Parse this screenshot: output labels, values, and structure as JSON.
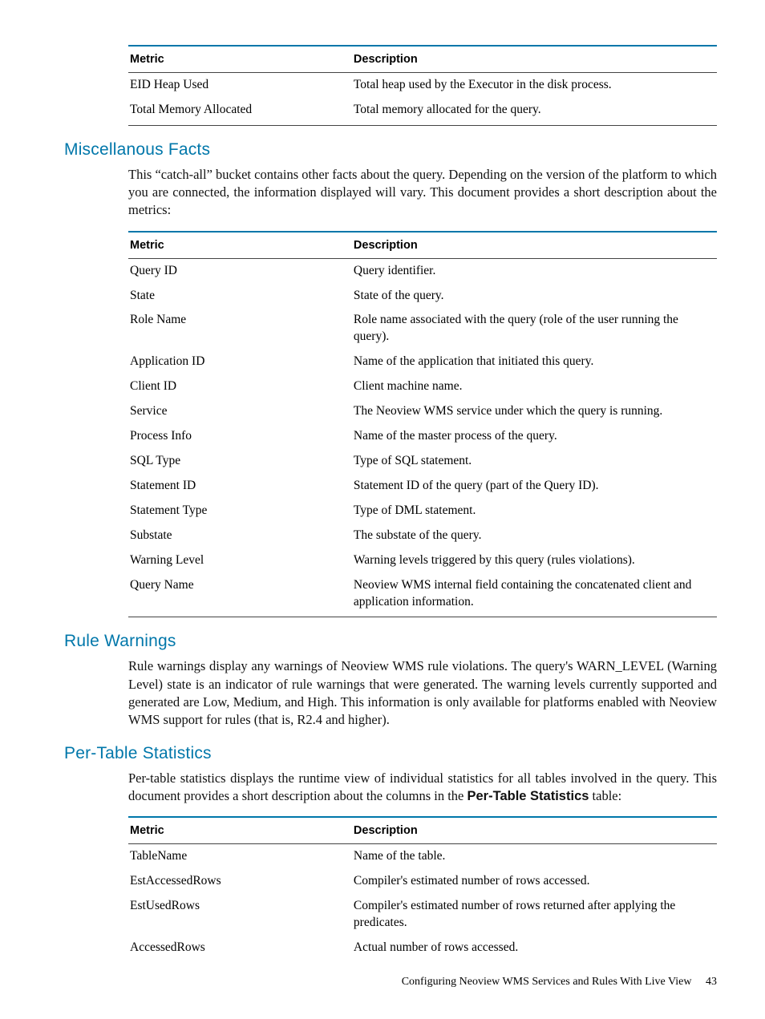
{
  "tables": {
    "heap": {
      "headers": {
        "metric": "Metric",
        "desc": "Description"
      },
      "rows": [
        {
          "metric": "EID Heap Used",
          "desc": "Total heap used by the Executor in the disk process."
        },
        {
          "metric": "Total Memory Allocated",
          "desc": "Total memory allocated for the query."
        }
      ]
    },
    "misc": {
      "headers": {
        "metric": "Metric",
        "desc": "Description"
      },
      "rows": [
        {
          "metric": "Query ID",
          "desc": "Query identifier."
        },
        {
          "metric": "State",
          "desc": "State of the query."
        },
        {
          "metric": "Role Name",
          "desc": "Role name associated with the query (role of the user running the query)."
        },
        {
          "metric": "Application ID",
          "desc": "Name of the application that initiated this query."
        },
        {
          "metric": "Client ID",
          "desc": "Client machine name."
        },
        {
          "metric": "Service",
          "desc": "The Neoview WMS service under which the query is running."
        },
        {
          "metric": "Process Info",
          "desc": "Name of the master process of the query."
        },
        {
          "metric": "SQL Type",
          "desc": "Type of SQL statement."
        },
        {
          "metric": "Statement ID",
          "desc": "Statement ID of the query (part of the Query ID)."
        },
        {
          "metric": "Statement Type",
          "desc": "Type of DML statement."
        },
        {
          "metric": "Substate",
          "desc": "The substate of the query."
        },
        {
          "metric": "Warning Level",
          "desc": "Warning levels triggered by this query (rules violations)."
        },
        {
          "metric": "Query Name",
          "desc": "Neoview WMS internal field containing the concatenated client and application information."
        }
      ]
    },
    "pertable": {
      "headers": {
        "metric": "Metric",
        "desc": "Description"
      },
      "rows": [
        {
          "metric": "TableName",
          "desc": "Name of the table."
        },
        {
          "metric": "EstAccessedRows",
          "desc": "Compiler's estimated number of rows accessed."
        },
        {
          "metric": "EstUsedRows",
          "desc": "Compiler's estimated number of rows returned after applying the predicates."
        },
        {
          "metric": "AccessedRows",
          "desc": "Actual number of rows accessed."
        }
      ]
    }
  },
  "sections": {
    "misc": {
      "heading": "Miscellanous Facts",
      "body": "This “catch-all” bucket contains other facts about the query. Depending on the version of the platform to which you are connected, the information displayed will vary. This document provides a short description about the metrics:"
    },
    "rule": {
      "heading": "Rule Warnings",
      "body": "Rule warnings display any warnings of Neoview WMS rule violations. The query's WARN_LEVEL (Warning Level) state is an indicator of rule warnings that were generated. The warning levels currently supported and generated are Low, Medium, and High. This information is only available for platforms enabled with Neoview WMS support for rules (that is, R2.4 and higher)."
    },
    "pertable": {
      "heading": "Per-Table Statistics",
      "body_pre": "Per-table statistics displays the runtime view of individual statistics for all tables involved in the query. This document provides a short description about the columns in the ",
      "body_bold": "Per-Table Statistics",
      "body_post": " table:"
    }
  },
  "footer": {
    "text": "Configuring Neoview WMS Services and Rules With Live View",
    "page": "43"
  }
}
